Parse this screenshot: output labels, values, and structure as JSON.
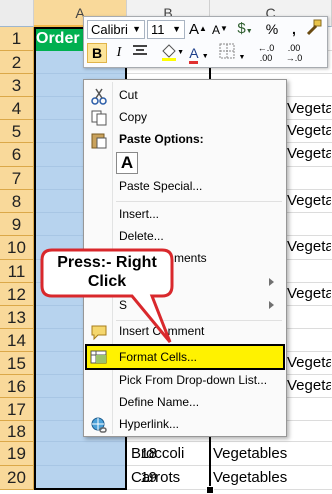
{
  "columns": [
    "A",
    "B",
    "C"
  ],
  "rows": [
    "1",
    "2",
    "3",
    "4",
    "5",
    "6",
    "7",
    "8",
    "9",
    "10",
    "11",
    "12",
    "13",
    "14",
    "15",
    "16",
    "17",
    "18",
    "19",
    "20"
  ],
  "header_cell": "Order",
  "visible_cells": {
    "r19": {
      "b_num": "18",
      "b_text": "Broccoli",
      "c": "Vegetables"
    },
    "r20": {
      "b_num": "19",
      "b_text": "Carrots",
      "c": "Vegetables"
    },
    "c_partial": [
      "Vegetables",
      "Vegetables",
      "Vegetables",
      "Vegetables",
      "Vegetables",
      "Vegetables",
      "Vegetables",
      "Vegetables"
    ]
  },
  "mini_toolbar": {
    "font_name": "Calibri",
    "font_size": "11",
    "grow_font": "A",
    "shrink_font": "A",
    "currency": "$",
    "percent": "%",
    "comma": ",",
    "bold": "B",
    "italic": "I",
    "fill_color": "A",
    "font_color": "A"
  },
  "context_menu": {
    "cut": "Cut",
    "copy": "Copy",
    "paste_options": "Paste Options:",
    "paste_icon": "A",
    "paste_special": "Paste Special...",
    "insert": "Insert...",
    "delete": "Delete...",
    "clear_contents": "ments",
    "filter": "",
    "sort": "S",
    "insert_comment": "Insert Comment",
    "format_cells": "Format Cells...",
    "pick_list": "Pick From Drop-down List...",
    "define_name": "Define Name...",
    "hyperlink": "Hyperlink..."
  },
  "callout": {
    "line1": "Press:- Right",
    "line2": "Click"
  },
  "colors": {
    "selection": "#b7d3ee",
    "highlight": "#fff200",
    "callout_border": "#d9282c",
    "header_fill": "#00b050"
  }
}
